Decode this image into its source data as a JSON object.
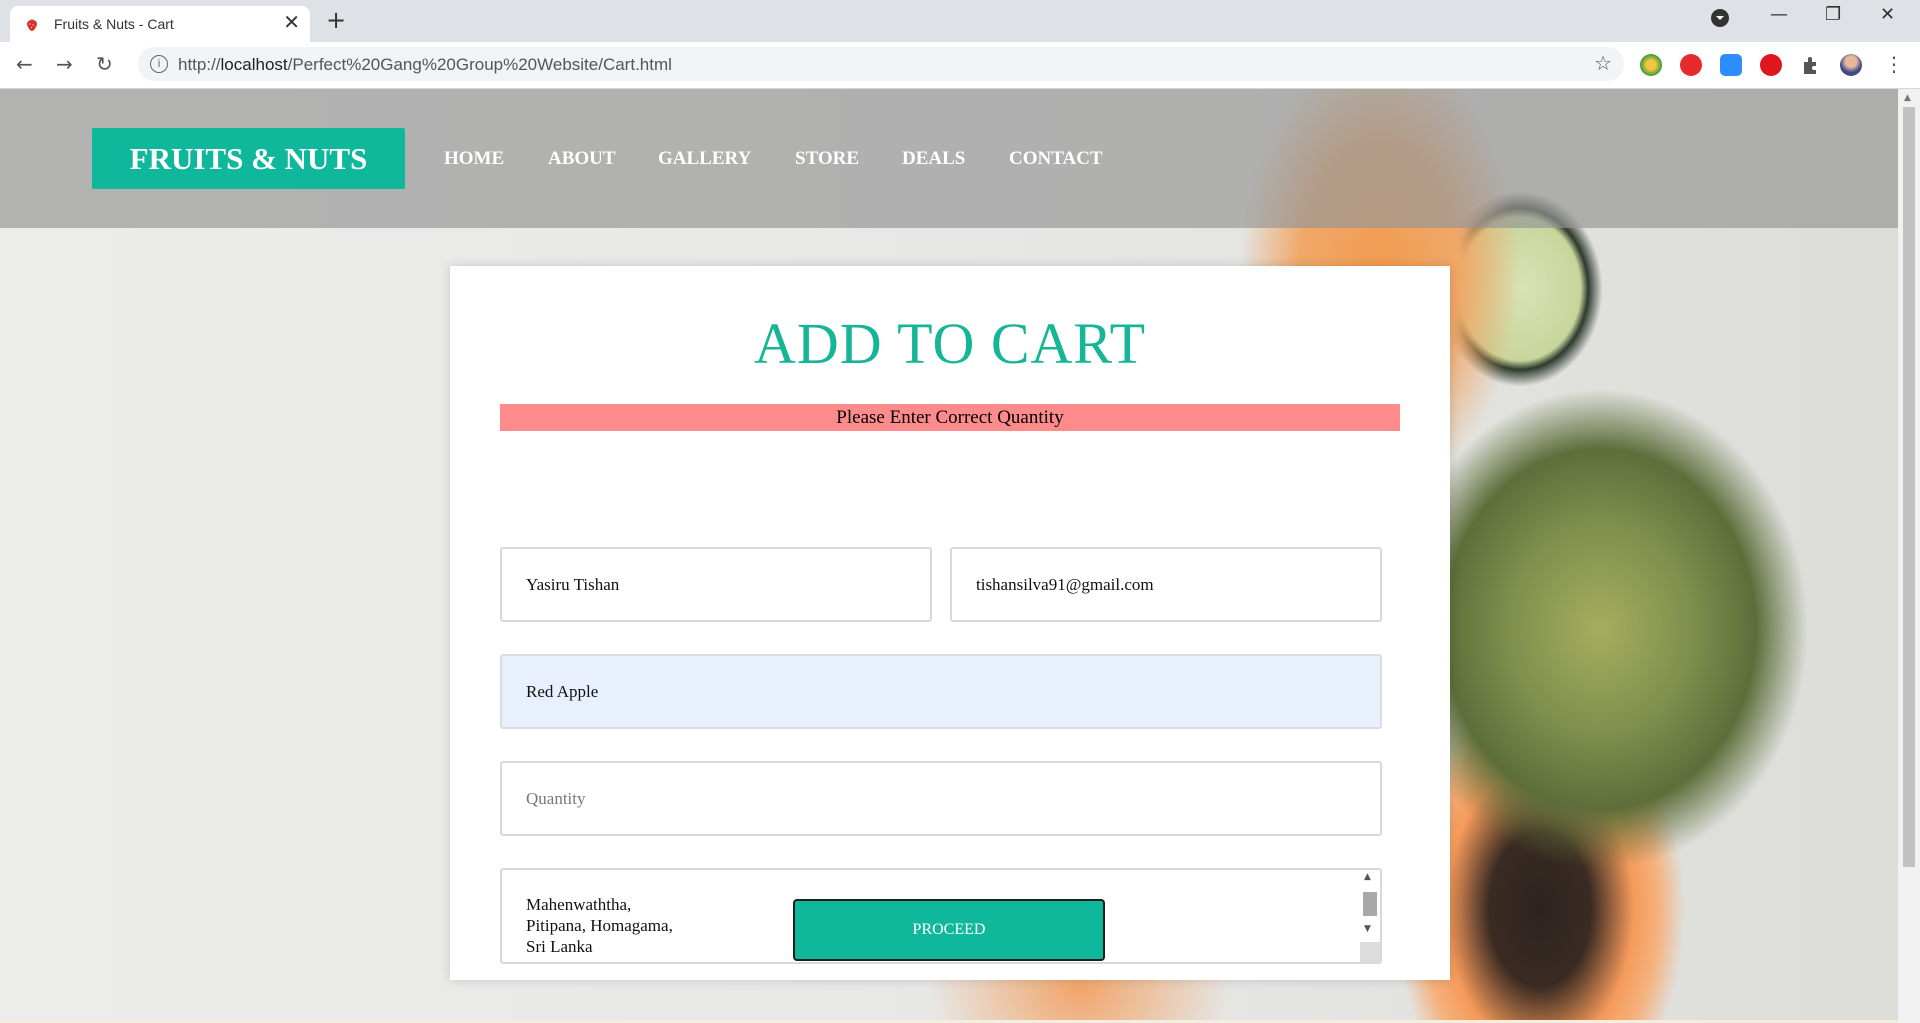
{
  "browser": {
    "tab_title": "Fruits & Nuts - Cart",
    "tab_close": "✕",
    "new_tab": "+",
    "url_prefix": "http://",
    "url_host": "localhost",
    "url_path": "/Perfect%20Gang%20Group%20Website/Cart.html",
    "window_controls": [
      "—",
      "❐",
      "✕"
    ]
  },
  "site": {
    "logo": "FRUITS & NUTS",
    "nav": [
      "HOME",
      "ABOUT",
      "GALLERY",
      "STORE",
      "DEALS",
      "CONTACT"
    ]
  },
  "form": {
    "heading": "ADD TO CART",
    "alert": "Please Enter Correct Quantity",
    "name_value": "Yasiru Tishan",
    "email_value": "tishansilva91@gmail.com",
    "product_value": "Red Apple",
    "quantity_placeholder": "Quantity",
    "address_value": "Mahenwaththa,\nPitipana, Homagama,\nSri Lanka",
    "submit_label": "PROCEED"
  },
  "colors": {
    "accent": "#0fb89a",
    "alert_bg": "#fe8b8c",
    "autofill_bg": "#e8f0fe"
  },
  "icons": [
    "strawberry-favicon-icon",
    "info-icon",
    "star-icon",
    "back-arrow-icon",
    "forward-arrow-icon",
    "reload-icon",
    "extensions-icon",
    "profile-avatar"
  ]
}
